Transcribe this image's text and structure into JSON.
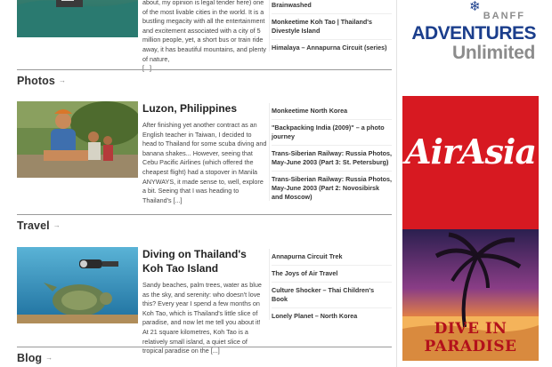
{
  "posts": [
    {
      "excerpt": "about, my opinion is legal tender here) one of the most livable cities in the world.  It is a bustling megacity with all the entertainment and excitement associated with a city of 5 million people, yet, a short bus or train ride away, it has beautiful mountains, and plenty of nature,",
      "more": "[...]",
      "related": [
        "Brainwashed",
        "Monkeetime Koh Tao | Thailand's Divestyle Island",
        "Himalaya – Annapurna Circuit (series)"
      ]
    },
    {
      "section": "Photos",
      "title": "Luzon, Philippines",
      "excerpt": "After finishing yet another contract as an English teacher in Taiwan, I decided to head to Thailand for some scuba diving and banana shakes... However, seeing that Cebu Pacific Airlines (which offered the cheapest flight) had a stopover in Manila ANYWAYS, it made sense to, well, explore a bit.        Seeing that I was heading to Thailand's",
      "more": "[...]",
      "related": [
        "Monkeetime North Korea",
        "\"Backpacking India (2009)\" – a photo journey",
        "Trans-Siberian Railway: Russia Photos, May-June 2003 (Part 3: St. Petersburg)",
        "Trans-Siberian Railway: Russia Photos, May-June 2003 (Part 2: Novosibirsk and Moscow)"
      ]
    },
    {
      "section": "Travel",
      "title": "Diving on Thailand's Koh Tao Island",
      "excerpt": "Sandy beaches, palm trees, water as blue as the sky, and serenity: who doesn't love this?  Every year I spend a few months on Koh Tao, which is Thailand's little slice of paradise, and now let me tell you about it! At 21 square kilometres, Koh Tao is a relatively small island, a quiet slice of tropical paradise on the",
      "more": "[...]",
      "related": [
        "Annapurna Circuit Trek",
        "The Joys of Air Travel",
        "Culture Shocker – Thai Children's Book",
        "Lonely Planet – North Korea"
      ]
    }
  ],
  "blog_section": "Blog",
  "arrow": "→",
  "ads": {
    "banff": {
      "small": "BANFF",
      "big": "ADVENTURES",
      "unlimited": "Unlimited"
    },
    "airasia": {
      "logo": "AirAsia",
      "dive": "DIVE IN",
      "paradise": "PARADISE"
    }
  },
  "colors": {
    "airasia_red": "#d71921",
    "banff_blue": "#1b3e8c",
    "banff_gray": "#8c8c8c"
  }
}
